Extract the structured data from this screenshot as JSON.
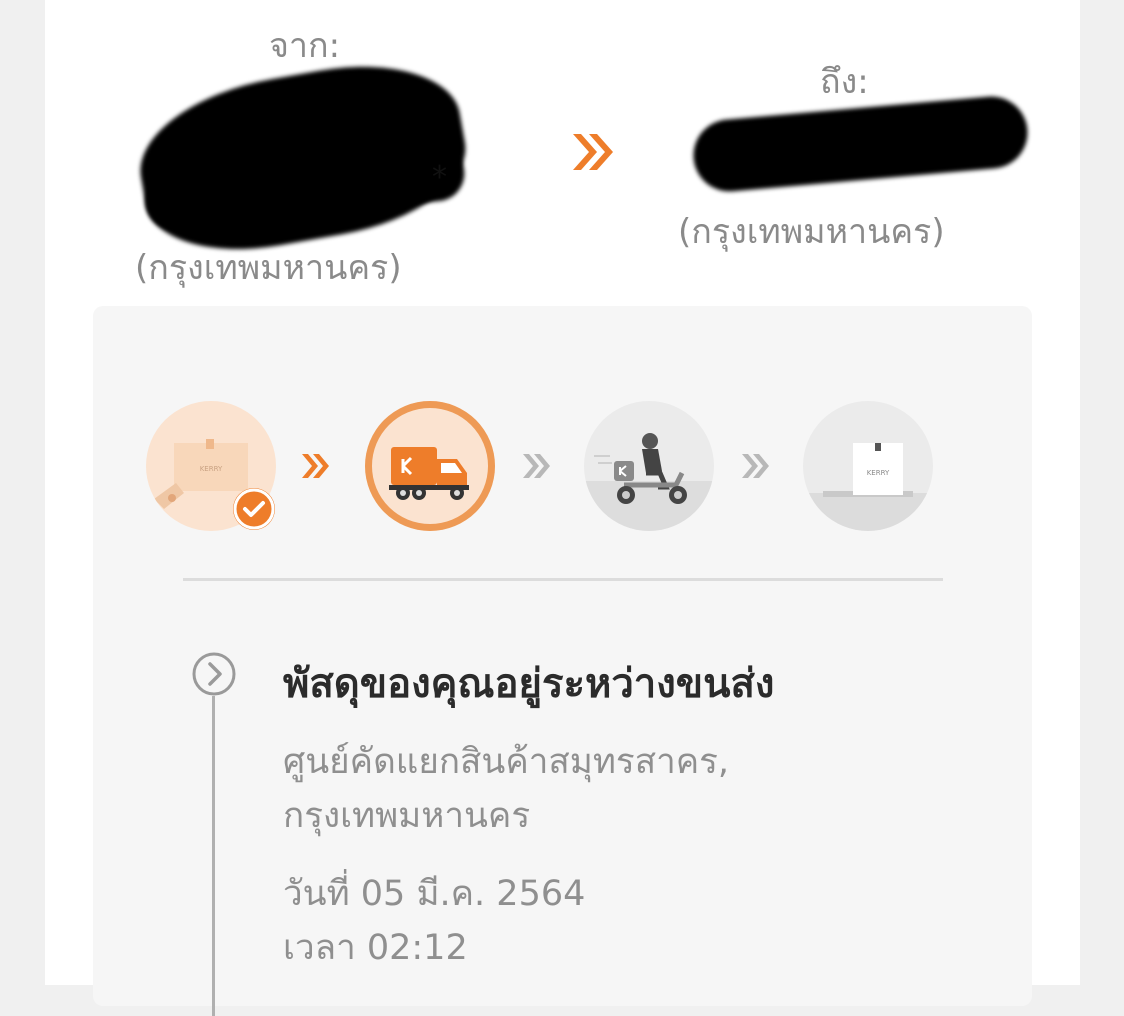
{
  "shipment": {
    "from_label": "จาก:",
    "from_province": "(กรุงเทพมหานคร)",
    "to_label": "ถึง:",
    "to_province": "(กรุงเทพมหานคร)",
    "asterisk": "*"
  },
  "colors": {
    "accent": "#ee7d2a",
    "accent_light": "#fbe3d0",
    "inactive": "#bdbdbd",
    "panel_bg": "#f6f6f6"
  },
  "progress": {
    "steps": [
      {
        "icon": "parcel-pickup-icon",
        "state": "done"
      },
      {
        "icon": "delivery-truck-icon",
        "state": "current"
      },
      {
        "icon": "scooter-courier-icon",
        "state": "pending"
      },
      {
        "icon": "delivered-box-icon",
        "state": "pending"
      }
    ],
    "completed_steps": 1,
    "total_steps": 4
  },
  "status": {
    "title": "พัสดุของคุณอยู่ระหว่างขนส่ง",
    "location_line1": "ศูนย์คัดแยกสินค้าสมุทรสาคร,",
    "location_line2": "กรุงเทพมหานคร",
    "date": "วันที่ 05 มี.ค. 2564",
    "time": "เวลา 02:12"
  }
}
